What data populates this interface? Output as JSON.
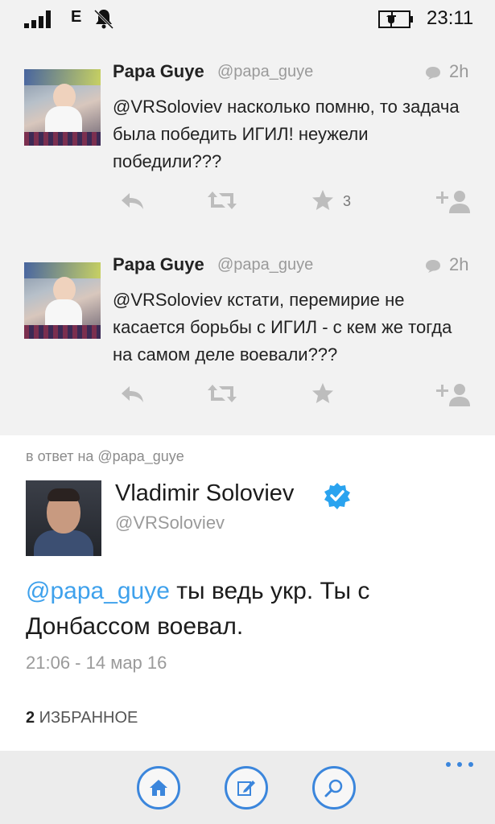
{
  "status_bar": {
    "network_type": "E",
    "time": "23:11",
    "icons": [
      "signal-icon",
      "alarm-icon",
      "battery-charging-icon"
    ]
  },
  "tweets": [
    {
      "display_name": "Papa Guye",
      "handle": "@papa_guye",
      "time": "2h",
      "text": "@VRSoloviev насколько помню, то задача была победить ИГИЛ! неужели  победили???",
      "fav_count": "3"
    },
    {
      "display_name": "Papa Guye",
      "handle": "@papa_guye",
      "time": "2h",
      "text": "@VRSoloviev кстати, перемирие не касается борьбы с ИГИЛ - с кем же тогда на самом деле воевали???",
      "fav_count": ""
    }
  ],
  "detail": {
    "reply_to": "в ответ на @papa_guye",
    "author_name": "Vladimir Soloviev",
    "author_handle": "@VRSoloviev",
    "mention": "@papa_guye",
    "text": " ты ведь укр. Ты с Донбассом воевал.",
    "timestamp": "21:06 - 14 мар 16",
    "fav_count": "2",
    "fav_label": " ИЗБРАННОЕ"
  },
  "colors": {
    "accent": "#3b86dc",
    "mention": "#3ea1ec",
    "verified": "#2aa3ef",
    "muted": "#9a9a9a"
  }
}
